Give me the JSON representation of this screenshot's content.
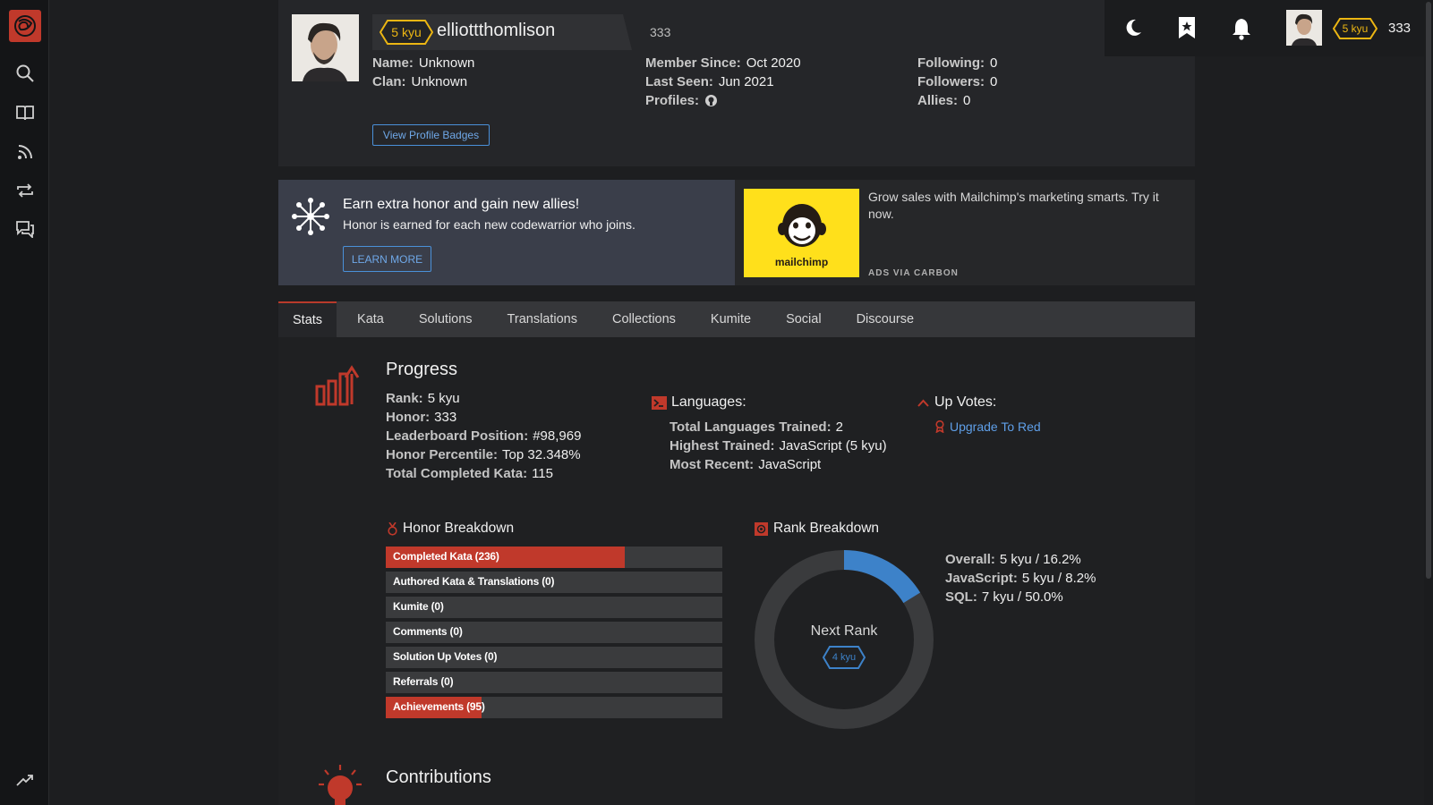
{
  "profile": {
    "rank": "5 kyu",
    "username": "elliottthomlison",
    "honor": "333",
    "name_label": "Name:",
    "name_value": "Unknown",
    "clan_label": "Clan:",
    "clan_value": "Unknown",
    "member_since_label": "Member Since:",
    "member_since_value": "Oct 2020",
    "last_seen_label": "Last Seen:",
    "last_seen_value": "Jun 2021",
    "profiles_label": "Profiles:",
    "following_label": "Following:",
    "following_value": "0",
    "followers_label": "Followers:",
    "followers_value": "0",
    "allies_label": "Allies:",
    "allies_value": "0",
    "badges_button": "View Profile Badges"
  },
  "topbar": {
    "rank": "5 kyu",
    "honor": "333"
  },
  "promo": {
    "title": "Earn extra honor and gain new allies!",
    "subtitle": "Honor is earned for each new codewarrior who joins.",
    "button": "LEARN MORE"
  },
  "ad": {
    "brand": "mailchimp",
    "text": "Grow sales with Mailchimp's marketing smarts. Try it now.",
    "via": "ADS VIA CARBON"
  },
  "tabs": [
    "Stats",
    "Kata",
    "Solutions",
    "Translations",
    "Collections",
    "Kumite",
    "Social",
    "Discourse"
  ],
  "progress": {
    "title": "Progress",
    "rank_label": "Rank:",
    "rank_value": "5 kyu",
    "honor_label": "Honor:",
    "honor_value": "333",
    "leaderboard_label": "Leaderboard Position:",
    "leaderboard_value": "#98,969",
    "percentile_label": "Honor Percentile:",
    "percentile_value": "Top 32.348%",
    "completed_label": "Total Completed Kata:",
    "completed_value": "115"
  },
  "languages": {
    "title": "Languages:",
    "trained_label": "Total Languages Trained:",
    "trained_value": "2",
    "highest_label": "Highest Trained:",
    "highest_value": "JavaScript (5 kyu)",
    "recent_label": "Most Recent:",
    "recent_value": "JavaScript"
  },
  "upvotes": {
    "title": "Up Votes:",
    "link": "Upgrade To Red"
  },
  "honor_breakdown": {
    "title": "Honor Breakdown",
    "items": [
      {
        "label": "Completed Kata (236)",
        "fill": 0.71
      },
      {
        "label": "Authored Kata & Translations (0)",
        "fill": 0
      },
      {
        "label": "Kumite (0)",
        "fill": 0
      },
      {
        "label": "Comments (0)",
        "fill": 0
      },
      {
        "label": "Solution Up Votes (0)",
        "fill": 0
      },
      {
        "label": "Referrals (0)",
        "fill": 0
      },
      {
        "label": "Achievements (95)",
        "fill": 0.285
      }
    ]
  },
  "rank_breakdown": {
    "title": "Rank Breakdown",
    "center_label": "Next Rank",
    "next_rank": "4 kyu",
    "progress": 0.162,
    "overall_label": "Overall:",
    "overall_value": "5 kyu / 16.2%",
    "js_label": "JavaScript:",
    "js_value": "5 kyu / 8.2%",
    "sql_label": "SQL:",
    "sql_value": "7 kyu / 50.0%"
  },
  "contributions": {
    "title": "Contributions"
  },
  "colors": {
    "accent": "#c0392b",
    "rank_yellow": "#ecb613",
    "link_blue": "#5f9fe8",
    "donut_blue": "#3d82c9"
  }
}
